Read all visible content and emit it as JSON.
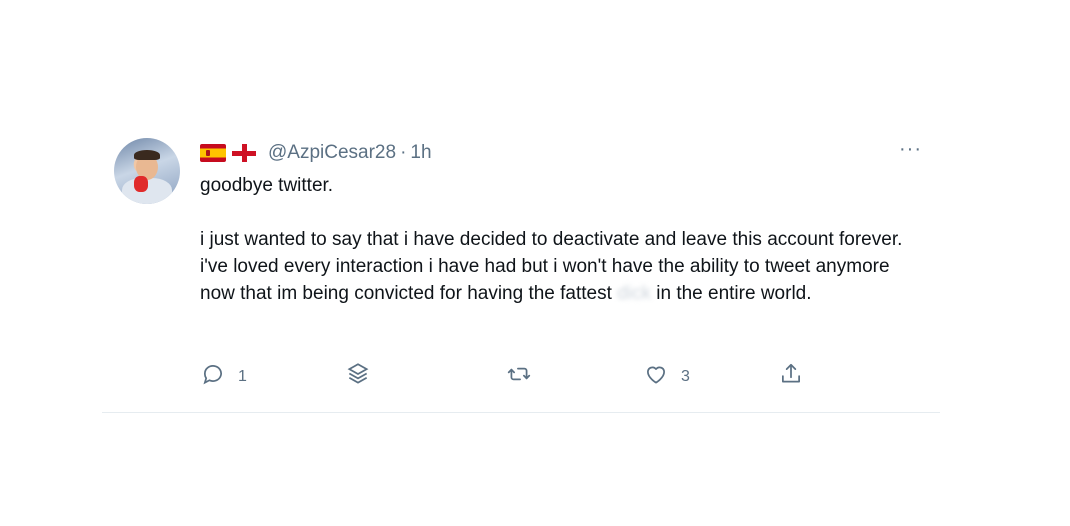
{
  "tweet": {
    "handle": "@AzpiCesar28",
    "separator": "·",
    "time": "1h",
    "more_label": "···",
    "body_part1": "goodbye twitter.\n\ni just wanted to say that i have decided to deactivate and leave this account forever. i've loved every interaction i have had but i won't have the ability to tweet anymore now that im being convicted for having the fattest ",
    "body_blurred": "dick",
    "body_part2": " in the entire world.",
    "actions": {
      "reply_count": "1",
      "retweet_count": "",
      "like_count": "3"
    }
  },
  "icons": {
    "reply": "reply-icon",
    "stack": "layers-icon",
    "retweet": "retweet-icon",
    "like": "heart-icon",
    "share": "share-icon"
  },
  "colors": {
    "secondary_text": "#5b7083",
    "divider": "#e6ecf0"
  }
}
